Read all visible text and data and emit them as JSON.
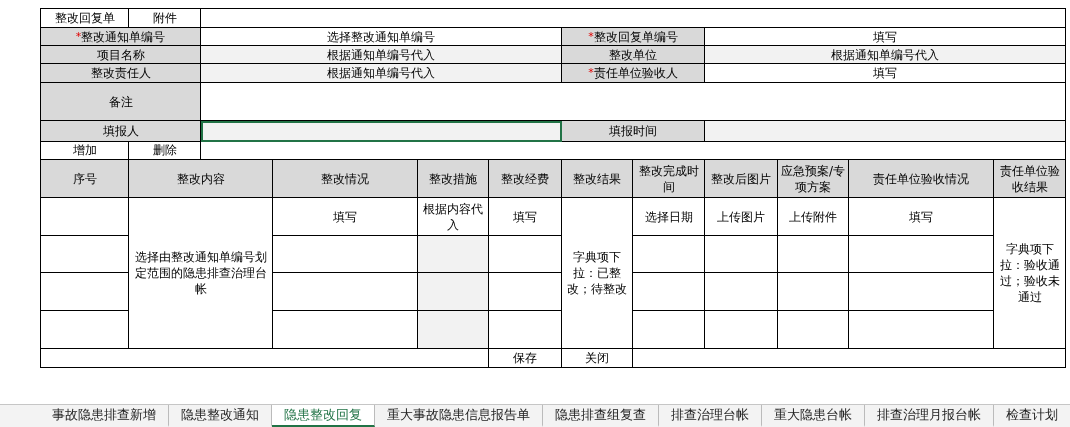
{
  "header": {
    "title": "整改回复单",
    "attachment": "附件"
  },
  "fields": [
    {
      "label": "整改通知单编号",
      "marker": "*",
      "value": "选择整改通知单编号",
      "autofill": false
    },
    {
      "label": "整改回复单编号",
      "marker": "*",
      "value": "填写",
      "autofill": false
    },
    {
      "label": "项目名称",
      "value": "根据通知单编号代入",
      "autofill": true
    },
    {
      "label": "整改单位",
      "value": "根据通知单编号代入",
      "autofill": true
    },
    {
      "label": "整改责任人",
      "value": "根据通知单编号代入",
      "autofill": true
    },
    {
      "label": "责任单位验收人",
      "marker": "*",
      "value": "填写",
      "autofill": false
    }
  ],
  "remark": {
    "label": "备注"
  },
  "reporter": {
    "label": "填报人",
    "selected": true
  },
  "report_time": {
    "label": "填报时间"
  },
  "row_actions": [
    "增加",
    "删除"
  ],
  "table": {
    "columns": [
      {
        "label": "序号",
        "merged": false,
        "autofill": false
      },
      {
        "label": "整改内容",
        "hint": "选择由整改通知单编号划定范围的隐患排查治理台帐",
        "merged": true,
        "autofill": false
      },
      {
        "label": "整改情况",
        "hint": "填写",
        "merged": false,
        "autofill": false
      },
      {
        "label": "整改措施",
        "hint": "根据内容代入",
        "merged": false,
        "autofill": true
      },
      {
        "label": "整改经费",
        "hint": "填写",
        "merged": false,
        "autofill": false
      },
      {
        "label": "整改结果",
        "hint": "字典项下拉：已整改；待整改",
        "merged": true,
        "autofill": false
      },
      {
        "label": "整改完成时间",
        "hint": "选择日期",
        "merged": false,
        "autofill": false
      },
      {
        "label": "整改后图片",
        "hint": "上传图片",
        "merged": false,
        "autofill": false
      },
      {
        "label": "应急预案/专项方案",
        "hint": "上传附件",
        "merged": false,
        "autofill": false
      },
      {
        "label": "责任单位验收情况",
        "hint": "填写",
        "merged": false,
        "autofill": false
      },
      {
        "label": "责任单位验收结果",
        "hint": "字典项下拉：验收通过；验收未通过",
        "merged": true,
        "autofill": false
      }
    ]
  },
  "footer_buttons": [
    "保存",
    "关闭"
  ],
  "sheet_tabs": [
    {
      "label": "事故隐患排查新增",
      "selected": false
    },
    {
      "label": "隐患整改通知",
      "selected": false
    },
    {
      "label": "隐患整改回复",
      "selected": true
    },
    {
      "label": "重大事故隐患信息报告单",
      "selected": false
    },
    {
      "label": "隐患排查组复查",
      "selected": false
    },
    {
      "label": "排查治理台帐",
      "selected": false
    },
    {
      "label": "重大隐患台帐",
      "selected": false
    },
    {
      "label": "排查治理月报台帐",
      "selected": false
    },
    {
      "label": "检查计划",
      "selected": false
    }
  ]
}
